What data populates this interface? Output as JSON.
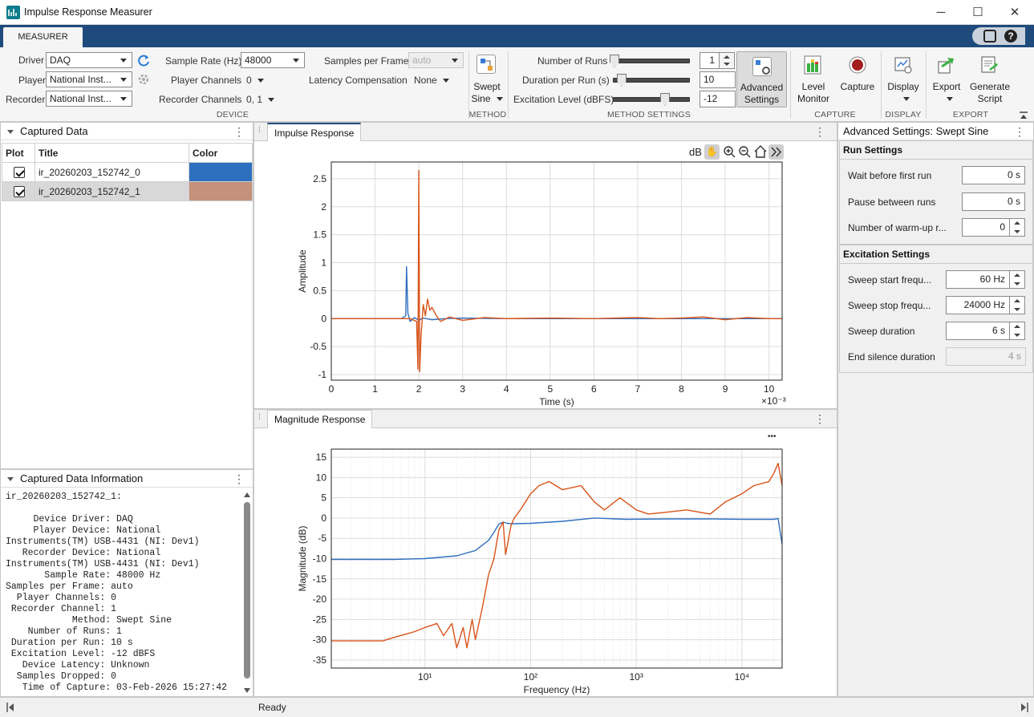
{
  "window": {
    "title": "Impulse Response Measurer",
    "minimize": "─",
    "maximize": "☐",
    "close": "✕"
  },
  "ribbon_tab": "MEASURER",
  "device": {
    "driver_label": "Driver",
    "driver_value": "DAQ",
    "player_label": "Player",
    "player_value": "National Inst...",
    "recorder_label": "Recorder",
    "recorder_value": "National Inst...",
    "sample_rate_label": "Sample Rate (Hz)",
    "sample_rate_value": "48000",
    "player_channels_label": "Player Channels",
    "player_channels_value": "0",
    "recorder_channels_label": "Recorder Channels",
    "recorder_channels_value": "0, 1",
    "samples_per_frame_label": "Samples per Frame",
    "samples_per_frame_value": "auto",
    "latency_label": "Latency Compensation",
    "latency_value": "None",
    "group": "DEVICE"
  },
  "method": {
    "button_line1": "Swept",
    "button_line2": "Sine",
    "group": "METHOD"
  },
  "method_settings": {
    "runs_label": "Number of Runs",
    "runs_value": "1",
    "duration_label": "Duration per Run (s)",
    "duration_value": "10",
    "excitation_label": "Excitation Level (dBFS)",
    "excitation_value": "-12",
    "advanced_line1": "Advanced",
    "advanced_line2": "Settings",
    "group": "METHOD SETTINGS",
    "runs_slider": 0.0,
    "duration_slider": 0.1,
    "excitation_slider": 0.7
  },
  "capture": {
    "level_line1": "Level",
    "level_line2": "Monitor",
    "capture_label": "Capture",
    "group": "CAPTURE"
  },
  "display": {
    "label": "Display",
    "group": "DISPLAY"
  },
  "export": {
    "export_label": "Export",
    "generate_line1": "Generate",
    "generate_line2": "Script",
    "group": "EXPORT"
  },
  "captured_data": {
    "title": "Captured Data",
    "columns": [
      "Plot",
      "Title",
      "Color"
    ],
    "rows": [
      {
        "title": "ir_20260203_152742_0",
        "color": "#2f6fbf",
        "checked": true
      },
      {
        "title": "ir_20260203_152742_1",
        "color": "#c4917a",
        "checked": true
      }
    ]
  },
  "info_panel": {
    "title": "Captured Data Information",
    "text": "ir_20260203_152742_1:\n\n     Device Driver: DAQ\n     Player Device: National\nInstruments(TM) USB-4431 (NI: Dev1)\n   Recorder Device: National\nInstruments(TM) USB-4431 (NI: Dev1)\n       Sample Rate: 48000 Hz\nSamples per Frame: auto\n  Player Channels: 0\n Recorder Channel: 1\n            Method: Swept Sine\n    Number of Runs: 1\n Duration per Run: 10 s\n Excitation Level: -12 dBFS\n   Device Latency: Unknown\n  Samples Dropped: 0\n   Time of Capture: 03-Feb-2026 15:27:42"
  },
  "impulse_tab": "Impulse Response",
  "magnitude_tab": "Magnitude Response",
  "axes_toolbar": {
    "db": "dB"
  },
  "mag_toolbar": "•••",
  "advanced_panel": {
    "title": "Advanced Settings: Swept Sine",
    "run_settings": "Run Settings",
    "wait_label": "Wait before first run",
    "wait_value": "0 s",
    "pause_label": "Pause between runs",
    "pause_value": "0 s",
    "warmup_label": "Number of warm-up r...",
    "warmup_value": "0",
    "excitation_settings": "Excitation Settings",
    "start_label": "Sweep start frequ...",
    "start_value": "60 Hz",
    "stop_label": "Sweep stop frequ...",
    "stop_value": "24000 Hz",
    "duration_label": "Sweep duration",
    "duration_value": "6 s",
    "silence_label": "End silence duration",
    "silence_value": "4 s"
  },
  "status": "Ready",
  "chart_data": [
    {
      "type": "line",
      "xlabel": "Time (s)",
      "ylabel": "Amplitude",
      "x_exponent": "×10⁻³",
      "xlim": [
        0,
        10.3
      ],
      "ylim": [
        -1.1,
        2.8
      ],
      "xticks": [
        0,
        1,
        2,
        3,
        4,
        5,
        6,
        7,
        8,
        9,
        10
      ],
      "yticks": [
        -1,
        -0.5,
        0,
        0.5,
        1,
        1.5,
        2,
        2.5
      ],
      "grid": true,
      "series": [
        {
          "color": "#2f6fbf",
          "x": [
            0,
            1.6,
            1.7,
            1.72,
            1.75,
            1.8,
            1.9,
            2.0,
            2.1,
            2.3,
            2.6,
            3.0,
            4.0,
            10.3
          ],
          "y": [
            0,
            0,
            0.05,
            0.93,
            0.1,
            -0.05,
            0.02,
            -0.03,
            0.01,
            -0.02,
            0,
            0.01,
            0,
            0
          ]
        },
        {
          "color": "#d95319",
          "x": [
            0,
            1.8,
            1.95,
            1.98,
            2.0,
            2.02,
            2.05,
            2.1,
            2.15,
            2.2,
            2.25,
            2.3,
            2.4,
            2.5,
            2.7,
            3.0,
            3.5,
            4.0,
            5.0,
            6.0,
            7.0,
            7.5,
            8.0,
            8.5,
            9.0,
            9.5,
            10.0,
            10.3
          ],
          "y": [
            0,
            0,
            -0.05,
            -0.9,
            2.65,
            -0.95,
            -0.3,
            0.25,
            0.05,
            0.35,
            0.15,
            0.2,
            0.05,
            -0.05,
            0.03,
            -0.03,
            0.02,
            0,
            0.01,
            0,
            0.02,
            0,
            0.01,
            0.03,
            -0.02,
            0.02,
            0,
            0
          ]
        }
      ]
    },
    {
      "type": "line",
      "xlabel": "Frequency (Hz)",
      "ylabel": "Magnitude (dB)",
      "x_scale": "log",
      "xlim": [
        1.3,
        24000
      ],
      "ylim": [
        -37,
        17
      ],
      "xticks": [
        10,
        100,
        1000,
        10000
      ],
      "xtick_labels": [
        "10¹",
        "10²",
        "10³",
        "10⁴"
      ],
      "yticks": [
        -35,
        -30,
        -25,
        -20,
        -15,
        -10,
        -5,
        0,
        5,
        10,
        15
      ],
      "grid": true,
      "series": [
        {
          "color": "#2f6fbf",
          "x": [
            1.3,
            5,
            10,
            20,
            30,
            40,
            45,
            50,
            55,
            60,
            65,
            70,
            100,
            200,
            400,
            800,
            2000,
            5000,
            10000,
            20000,
            22000,
            24000
          ],
          "y": [
            -10.2,
            -10.2,
            -10,
            -9.3,
            -8,
            -5.5,
            -3.5,
            -1.5,
            -1,
            -1.3,
            -1.4,
            -1.4,
            -1.3,
            -0.8,
            0,
            -0.3,
            -0.2,
            -0.2,
            -0.3,
            -0.3,
            -0.1,
            -6.5
          ]
        },
        {
          "color": "#d95319",
          "x": [
            1.3,
            4,
            5,
            8,
            10,
            13,
            15,
            18,
            20,
            23,
            25,
            28,
            30,
            35,
            40,
            45,
            50,
            55,
            58,
            62,
            65,
            70,
            80,
            100,
            120,
            150,
            200,
            300,
            400,
            500,
            700,
            1000,
            1300,
            2000,
            3000,
            5000,
            7000,
            10000,
            13000,
            18000,
            20000,
            22000,
            24000
          ],
          "y": [
            -30.3,
            -30.3,
            -29.5,
            -28,
            -27,
            -26,
            -29,
            -26,
            -32,
            -27,
            -32,
            -25,
            -30,
            -22,
            -14,
            -10,
            -3,
            -1,
            -9,
            -5,
            -2,
            0,
            2,
            6,
            8,
            9,
            7,
            8,
            4,
            2,
            5,
            2,
            1,
            1.5,
            2,
            1,
            4,
            6,
            8,
            9,
            11,
            13.5,
            8
          ]
        }
      ]
    }
  ]
}
